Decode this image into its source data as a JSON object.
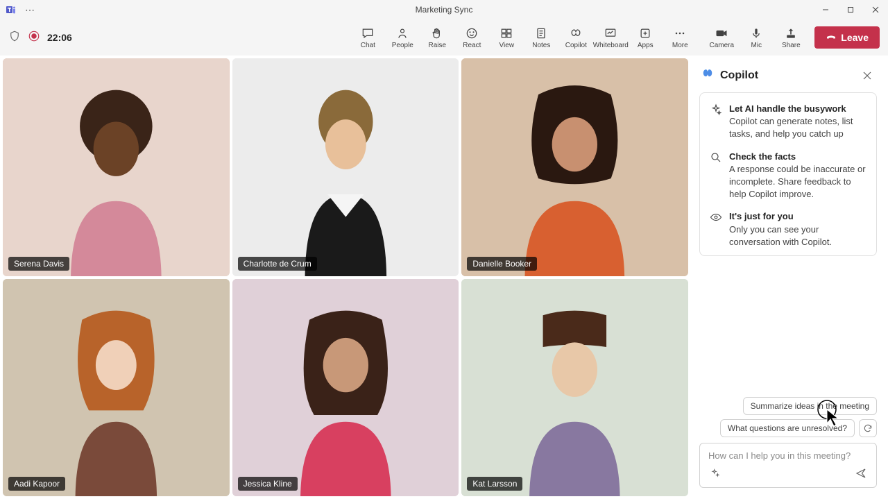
{
  "window": {
    "title": "Marketing Sync"
  },
  "meeting": {
    "timer": "22:06",
    "recording": true
  },
  "toolbar": {
    "chat": "Chat",
    "people": "People",
    "raise": "Raise",
    "react": "React",
    "view": "View",
    "notes": "Notes",
    "copilot": "Copilot",
    "whiteboard": "Whiteboard",
    "apps": "Apps",
    "more": "More",
    "camera": "Camera",
    "mic": "Mic",
    "share": "Share",
    "leave": "Leave"
  },
  "participants": [
    {
      "name": "Serena Davis"
    },
    {
      "name": "Charlotte de Crum"
    },
    {
      "name": "Danielle Booker"
    },
    {
      "name": "Aadi Kapoor"
    },
    {
      "name": "Jessica Kline"
    },
    {
      "name": "Kat Larsson"
    }
  ],
  "copilot": {
    "title": "Copilot",
    "card": [
      {
        "title": "Let AI handle the busywork",
        "body": "Copilot can generate notes, list tasks, and help you catch up"
      },
      {
        "title": "Check the facts",
        "body": "A response could be inaccurate or incomplete. Share feedback to help Copilot improve."
      },
      {
        "title": "It's just for you",
        "body": "Only you can see your conversation with Copilot."
      }
    ],
    "suggestions": [
      "Summarize ideas in the meeting",
      "What questions are unresolved?"
    ],
    "input_placeholder": "How can I help you in this meeting?"
  }
}
